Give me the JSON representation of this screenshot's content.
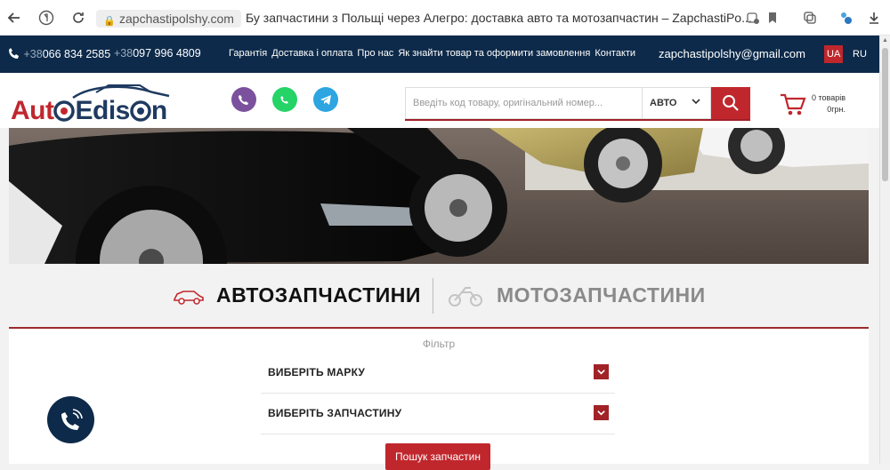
{
  "browser": {
    "url": "zapchastipolshy.com",
    "title": "Бу запчастини з Польщі через Алегро: доставка авто та мотозапчастин – ZapchastiPo..."
  },
  "topbar": {
    "phone1_code": "+38",
    "phone1_num": "066 834 2585",
    "phone2_code": "+38",
    "phone2_num": "097 996 4809",
    "nav": [
      "Гарантія",
      "Доставка і оплата",
      "Про нас",
      "Як знайти товар та оформити замовлення",
      "Контакти"
    ],
    "email": "zapchastipolshy@gmail.com",
    "lang_ua": "UA",
    "lang_ru": "RU"
  },
  "header": {
    "logo_part1": "Aut",
    "logo_part2": "Edis",
    "logo_part3": "n",
    "search_placeholder": "Введіть код товару, оригінальний номер...",
    "search_category": "АВТО",
    "cart_count": "0 товарів",
    "cart_sum": "0грн."
  },
  "categories": {
    "auto": "АВТОЗАПЧАСТИНИ",
    "moto": "МОТОЗАПЧАСТИНИ"
  },
  "filter": {
    "title": "Фільтр",
    "brand_label": "ВИБЕРІТЬ МАРКУ",
    "part_label": "ВИБЕРІТЬ ЗАПЧАСТИНУ",
    "search_button": "Пошук запчастин"
  },
  "icons": {
    "back": "arrow-left-icon",
    "yandex": "yandex-icon",
    "reload": "reload-icon",
    "lock": "lock-icon",
    "phone": "phone-icon",
    "viber": "viber-icon",
    "whatsapp": "whatsapp-icon",
    "telegram": "telegram-icon",
    "search": "search-icon",
    "cart": "cart-icon",
    "car": "car-icon",
    "moto": "motorcycle-icon",
    "chevron": "chevron-down-icon",
    "call": "call-icon"
  },
  "colors": {
    "navy": "#0d2a4a",
    "red": "#c0272d",
    "viber": "#7b519d",
    "whatsapp": "#25d366",
    "telegram": "#2ca5e0"
  }
}
